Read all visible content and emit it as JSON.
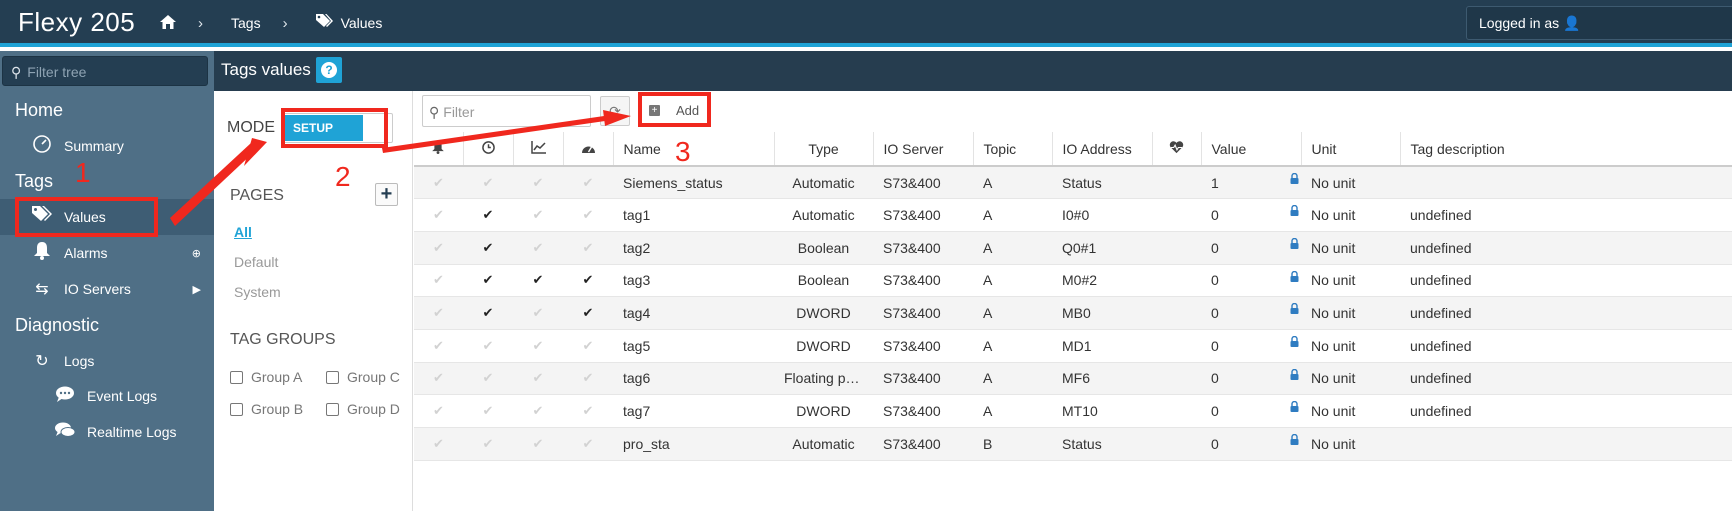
{
  "header": {
    "brand": "Flexy 205",
    "breadcrumb": [
      {
        "label": "Tags",
        "icon": "tag-icon"
      },
      {
        "label": "Values",
        "icon": "tags-icon"
      }
    ],
    "login_text": "Logged in as"
  },
  "sidebar": {
    "filter_placeholder": "Filter tree",
    "sections": {
      "home": "Home",
      "tags": "Tags",
      "diagnostic": "Diagnostic"
    },
    "items": {
      "summary": "Summary",
      "values": "Values",
      "alarms": "Alarms",
      "io_servers": "IO Servers",
      "logs": "Logs",
      "event_logs": "Event Logs",
      "realtime_logs": "Realtime Logs"
    }
  },
  "page": {
    "title": "Tags values",
    "help_label": "?"
  },
  "left_panel": {
    "mode_label": "MODE",
    "mode_value": "SETUP",
    "pages_label": "PAGES",
    "pages": [
      "All",
      "Default",
      "System"
    ],
    "tag_groups_label": "TAG GROUPS",
    "groups": [
      "Group A",
      "Group C",
      "Group B",
      "Group D"
    ]
  },
  "toolbar": {
    "filter_placeholder": "Filter",
    "add_label": "Add"
  },
  "table": {
    "columns": [
      "Name",
      "Type",
      "IO Server",
      "Topic",
      "IO Address",
      "Value",
      "Unit",
      "Tag description"
    ],
    "rows": [
      {
        "name": "Siemens_status",
        "type": "Automatic",
        "io_server": "S73&400",
        "topic": "A",
        "io_address": "Status",
        "value": "1",
        "unit": "No unit",
        "description": "",
        "checks": [
          false,
          false,
          false,
          false
        ]
      },
      {
        "name": "tag1",
        "type": "Automatic",
        "io_server": "S73&400",
        "topic": "A",
        "io_address": "I0#0",
        "value": "0",
        "unit": "No unit",
        "description": "undefined",
        "checks": [
          false,
          true,
          false,
          false
        ]
      },
      {
        "name": "tag2",
        "type": "Boolean",
        "io_server": "S73&400",
        "topic": "A",
        "io_address": "Q0#1",
        "value": "0",
        "unit": "No unit",
        "description": "undefined",
        "checks": [
          false,
          true,
          false,
          false
        ]
      },
      {
        "name": "tag3",
        "type": "Boolean",
        "io_server": "S73&400",
        "topic": "A",
        "io_address": "M0#2",
        "value": "0",
        "unit": "No unit",
        "description": "undefined",
        "checks": [
          false,
          true,
          true,
          true
        ]
      },
      {
        "name": "tag4",
        "type": "DWORD",
        "io_server": "S73&400",
        "topic": "A",
        "io_address": "MB0",
        "value": "0",
        "unit": "No unit",
        "description": "undefined",
        "checks": [
          false,
          true,
          false,
          true
        ]
      },
      {
        "name": "tag5",
        "type": "DWORD",
        "io_server": "S73&400",
        "topic": "A",
        "io_address": "MD1",
        "value": "0",
        "unit": "No unit",
        "description": "undefined",
        "checks": [
          false,
          false,
          false,
          false
        ]
      },
      {
        "name": "tag6",
        "type": "Floating po...",
        "io_server": "S73&400",
        "topic": "A",
        "io_address": "MF6",
        "value": "0",
        "unit": "No unit",
        "description": "undefined",
        "checks": [
          false,
          false,
          false,
          false
        ]
      },
      {
        "name": "tag7",
        "type": "DWORD",
        "io_server": "S73&400",
        "topic": "A",
        "io_address": "MT10",
        "value": "0",
        "unit": "No unit",
        "description": "undefined",
        "checks": [
          false,
          false,
          false,
          false
        ]
      },
      {
        "name": "pro_sta",
        "type": "Automatic",
        "io_server": "S73&400",
        "topic": "B",
        "io_address": "Status",
        "value": "0",
        "unit": "No unit",
        "description": "",
        "checks": [
          false,
          false,
          false,
          false
        ]
      }
    ]
  },
  "annotations": {
    "step1": "1",
    "step2": "2",
    "step3": "3"
  },
  "colors": {
    "topbar": "#243e52",
    "accent": "#1fa3d6",
    "sidebar": "#4f6f86",
    "annotation": "#f0281e"
  }
}
